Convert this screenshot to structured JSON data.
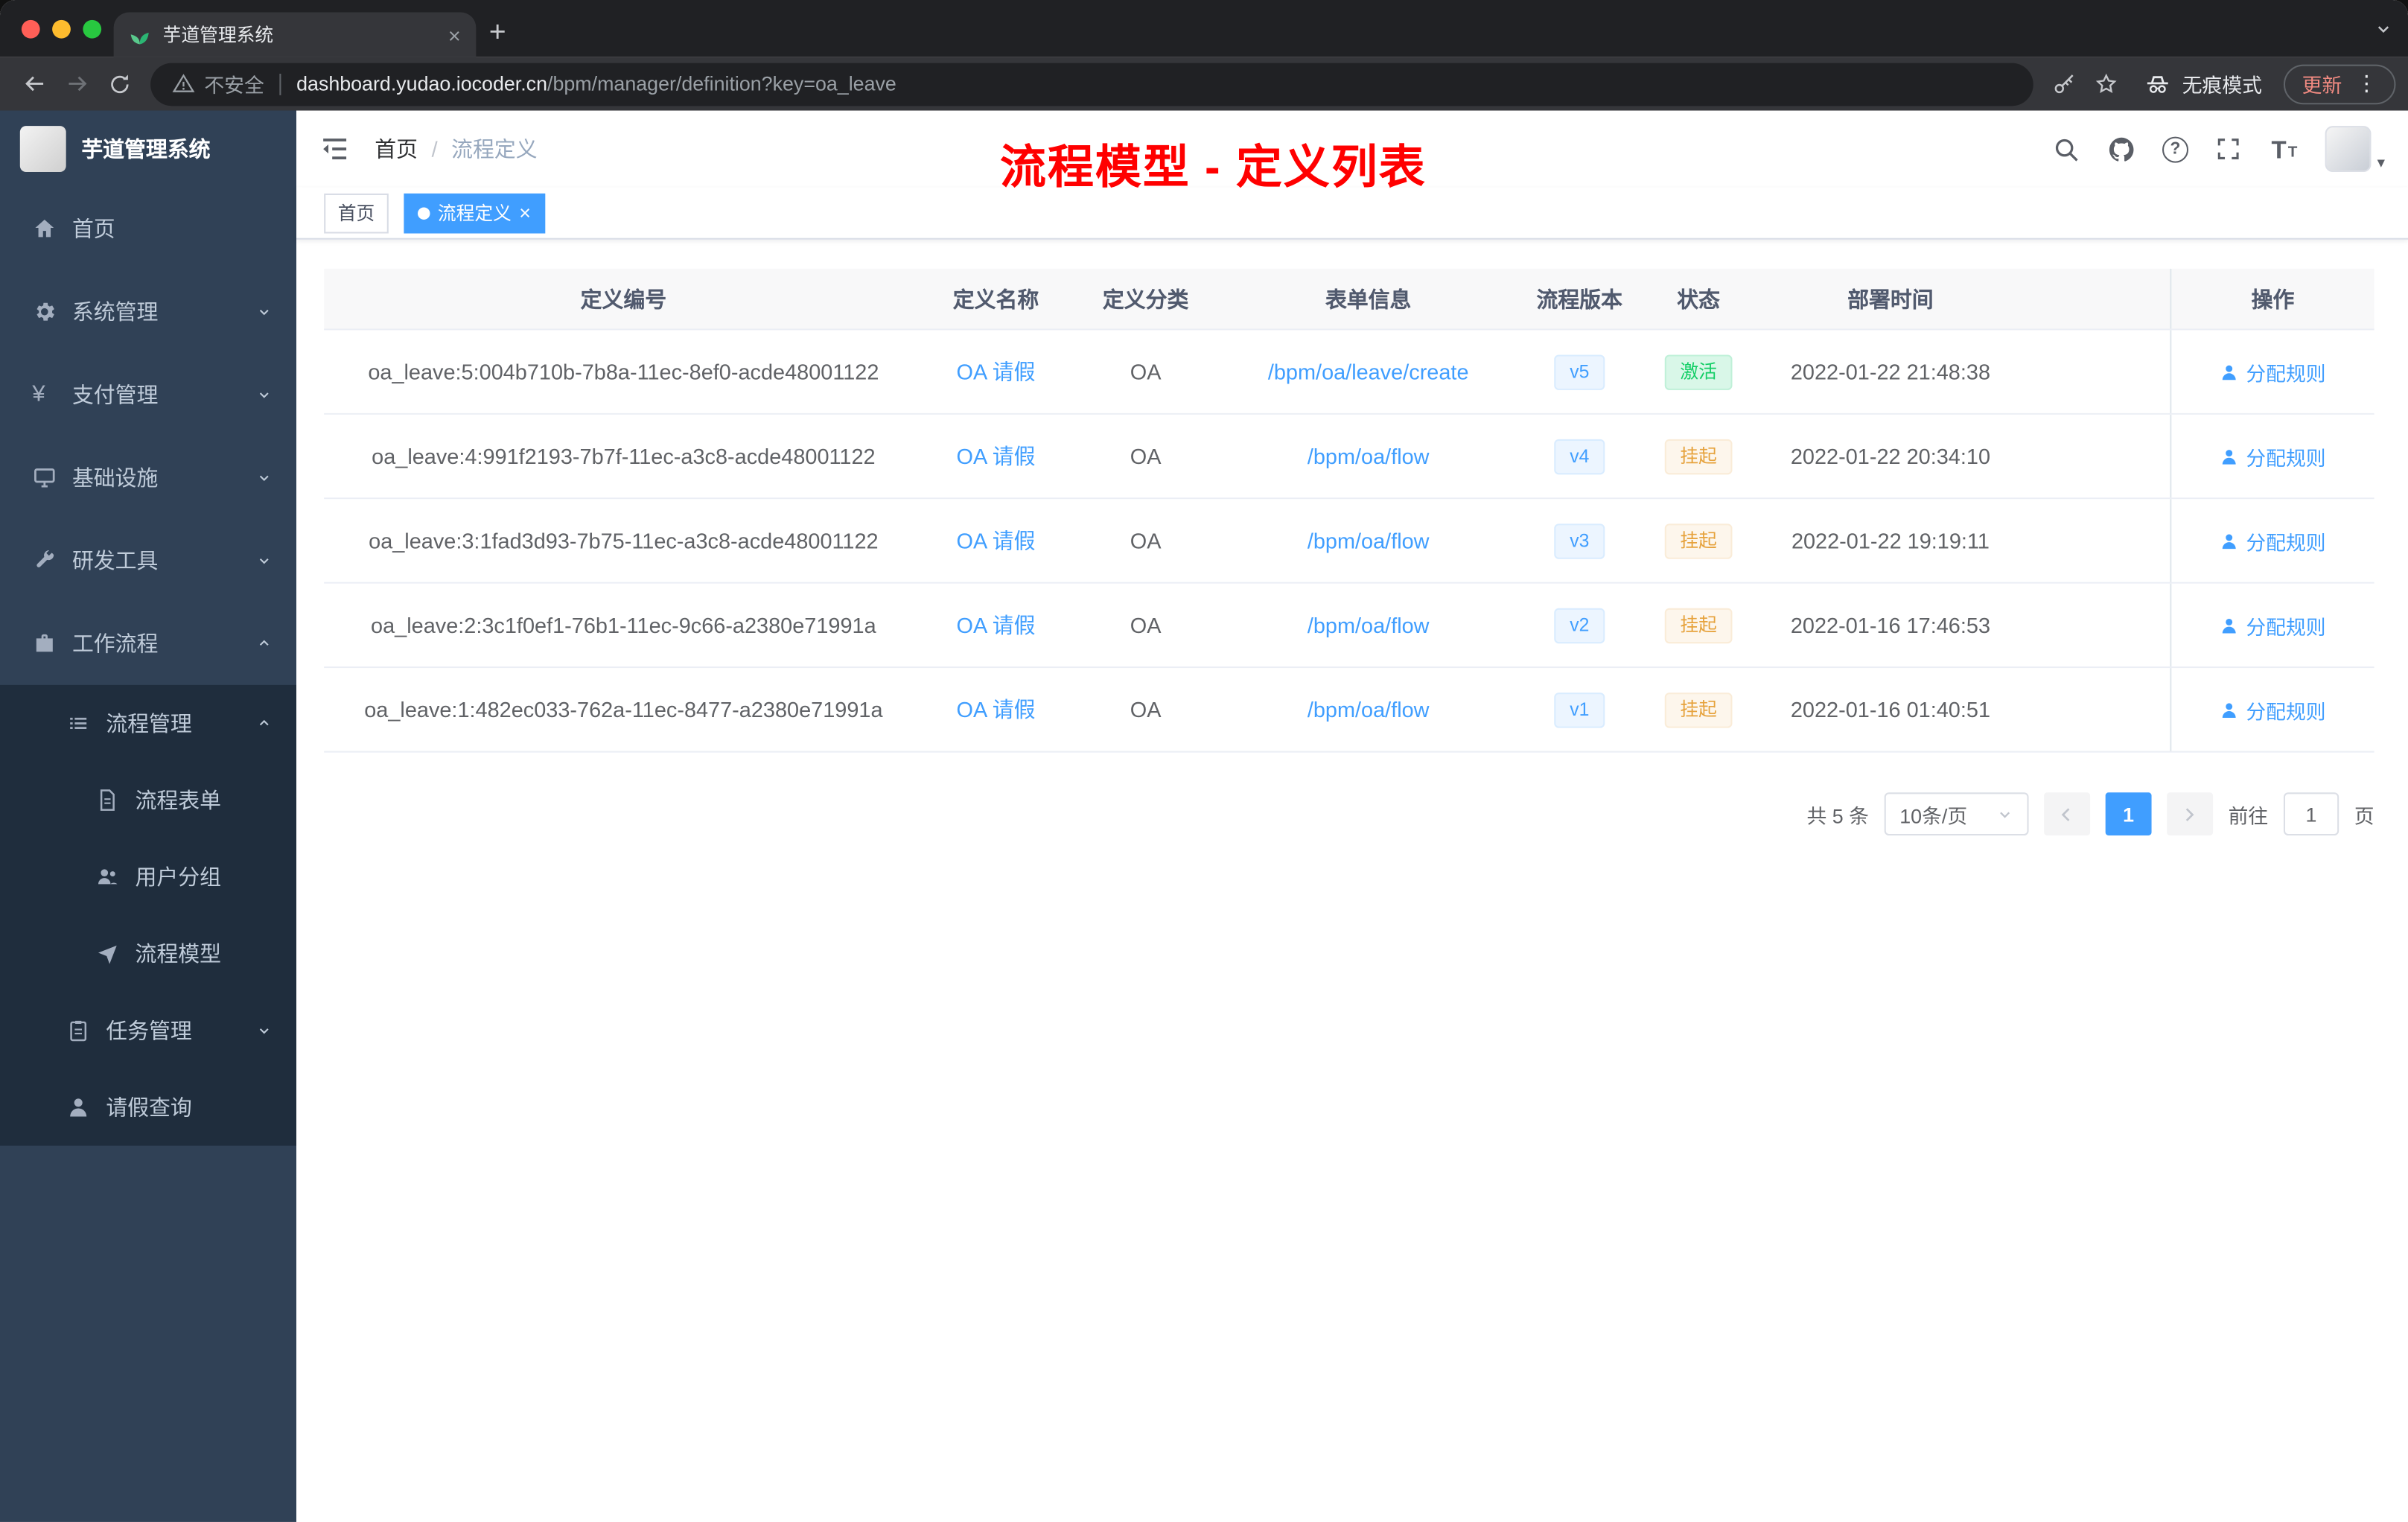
{
  "browser": {
    "tab_title": "芋道管理系统",
    "security_label": "不安全",
    "url_host": "dashboard.yudao.iocoder.cn",
    "url_path": "/bpm/manager/definition?key=oa_leave",
    "incognito_label": "无痕模式",
    "update_label": "更新"
  },
  "sidebar": {
    "logo_title": "芋道管理系统",
    "items": [
      {
        "label": "首页"
      },
      {
        "label": "系统管理"
      },
      {
        "label": "支付管理"
      },
      {
        "label": "基础设施"
      },
      {
        "label": "研发工具"
      },
      {
        "label": "工作流程"
      },
      {
        "label": "流程管理"
      },
      {
        "label": "流程表单"
      },
      {
        "label": "用户分组"
      },
      {
        "label": "流程模型"
      },
      {
        "label": "任务管理"
      },
      {
        "label": "请假查询"
      }
    ]
  },
  "header": {
    "breadcrumb_home": "首页",
    "breadcrumb_separator": "/",
    "breadcrumb_current": "流程定义",
    "annotation": "流程模型 - 定义列表"
  },
  "tags": {
    "home": "首页",
    "current": "流程定义"
  },
  "table": {
    "columns": [
      "定义编号",
      "定义名称",
      "定义分类",
      "表单信息",
      "流程版本",
      "状态",
      "部署时间",
      "操作"
    ],
    "rows": [
      {
        "id": "oa_leave:5:004b710b-7b8a-11ec-8ef0-acde48001122",
        "name": "OA 请假",
        "category": "OA",
        "form": "/bpm/oa/leave/create",
        "version": "v5",
        "status": "激活",
        "time": "2022-01-22 21:48:38",
        "action": "分配规则"
      },
      {
        "id": "oa_leave:4:991f2193-7b7f-11ec-a3c8-acde48001122",
        "name": "OA 请假",
        "category": "OA",
        "form": "/bpm/oa/flow",
        "version": "v4",
        "status": "挂起",
        "time": "2022-01-22 20:34:10",
        "action": "分配规则"
      },
      {
        "id": "oa_leave:3:1fad3d93-7b75-11ec-a3c8-acde48001122",
        "name": "OA 请假",
        "category": "OA",
        "form": "/bpm/oa/flow",
        "version": "v3",
        "status": "挂起",
        "time": "2022-01-22 19:19:11",
        "action": "分配规则"
      },
      {
        "id": "oa_leave:2:3c1f0ef1-76b1-11ec-9c66-a2380e71991a",
        "name": "OA 请假",
        "category": "OA",
        "form": "/bpm/oa/flow",
        "version": "v2",
        "status": "挂起",
        "time": "2022-01-16 17:46:53",
        "action": "分配规则"
      },
      {
        "id": "oa_leave:1:482ec033-762a-11ec-8477-a2380e71991a",
        "name": "OA 请假",
        "category": "OA",
        "form": "/bpm/oa/flow",
        "version": "v1",
        "status": "挂起",
        "time": "2022-01-16 01:40:51",
        "action": "分配规则"
      }
    ]
  },
  "pagination": {
    "total": "共 5 条",
    "page_size": "10条/页",
    "current_page": "1",
    "goto_label": "前往",
    "goto_value": "1",
    "page_unit": "页"
  },
  "glyphs": {
    "plus": "+",
    "close": "×",
    "question": "?",
    "yen": "¥",
    "dots": "⋮",
    "caret_down": "▾",
    "font_large": "T",
    "font_small": "T"
  },
  "colors": {
    "accent": "#409eff",
    "annotation_red": "#ff0000",
    "success_green": "#13ce66",
    "warning_orange": "#e6a23c",
    "sidebar_bg": "#304156",
    "submenu_bg": "#1f2d3d"
  }
}
